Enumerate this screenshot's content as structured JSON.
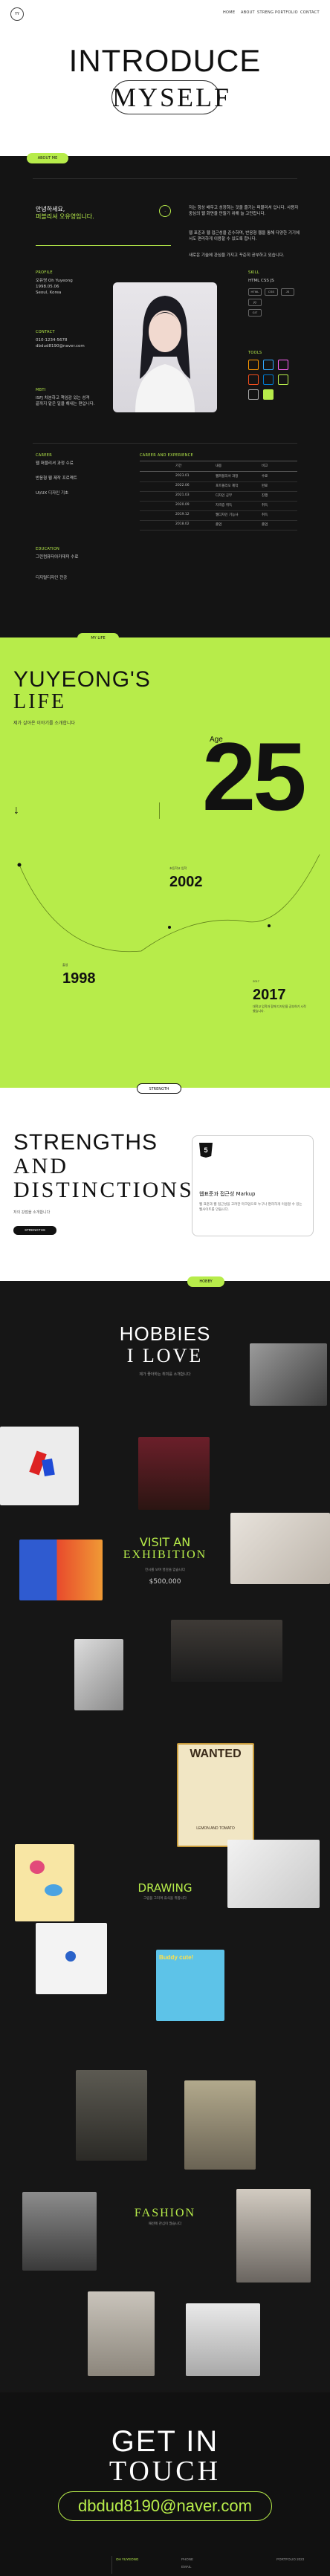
{
  "header": {
    "logo": "YY",
    "nav": [
      "HOME",
      "ABOUT",
      "STRENG",
      "PORTFOLIO",
      "CONTACT"
    ],
    "title_line1": "INTRODUCE",
    "title_line2": "MYSELF"
  },
  "about": {
    "tab": "ABOUT ME",
    "greeting_line1": "안녕하세요,",
    "greeting_line2": "퍼블리셔 오유영입니다.",
    "intro_paragraph": "저는 항상 배우고 성장하는 것을 즐기는 퍼블리셔 입니다. 사용자 중심의 웹 화면을 만들기 위해 늘 고민합니다.",
    "intro_paragraph2": "웹 표준과 웹 접근성을 준수하며, 반응형 웹을 통해 다양한 기기에서도 편리하게 이용할 수 있도록 합니다.",
    "intro_paragraph3": "새로운 기술에 관심을 가지고 꾸준히 공부하고 있습니다.",
    "profile_label": "PROFILE",
    "profile_name": "오유영 Oh Yuyeong",
    "profile_birth": "1998.05.06",
    "profile_addr": "Seoul, Korea",
    "contact_label": "CONTACT",
    "contact_phone": "010-1234-5678",
    "contact_email": "dbdud8190@naver.com",
    "mbti_label": "MBTI",
    "mbti_text": "ISFJ 차분하고 책임감 있는 성격",
    "mbti_text2": "끝까지 맡은 일을 해내는 편입니다.",
    "skill_label": "SKILL",
    "skill_text": "HTML CSS JS",
    "tools_label": "TOOLS",
    "career_label": "CAREER",
    "career_lines": [
      "웹 퍼블리셔 과정 수료",
      "반응형 웹 제작 프로젝트",
      "UI/UX 디자인 기초"
    ],
    "edu_label": "EDUCATION",
    "edu_lines": [
      "그린컴퓨터아카데미 수료",
      "디지털디자인 전공"
    ],
    "table_title": "CAREER AND EXPERIENCE",
    "table_header": [
      "기간",
      "내용",
      "비고"
    ],
    "table_rows": [
      [
        "2023.01",
        "웹퍼블리셔 과정",
        "수료"
      ],
      [
        "2022.06",
        "포트폴리오 제작",
        "완료"
      ],
      [
        "2021.03",
        "디자인 공부",
        "진행"
      ],
      [
        "2020.09",
        "자격증 취득",
        "취득"
      ],
      [
        "2019.12",
        "웹디자인 기능사",
        "취득"
      ],
      [
        "2018.02",
        "졸업",
        "졸업"
      ]
    ]
  },
  "life": {
    "tab": "MY LIFE",
    "title1": "YUYEONG'S",
    "title2": "LIFE",
    "subtitle": "제가 살아온 이야기를 소개합니다",
    "age_label": "Age",
    "age_value": "25",
    "years": [
      {
        "year": "2002",
        "note": "초등학교 입학"
      },
      {
        "year": "1998",
        "note": "출생"
      },
      {
        "year": "2017",
        "note": "대학교 입학과 함께 디자인을 공부하기 시작했습니다."
      }
    ]
  },
  "strengths": {
    "tab": "STRENGTH",
    "title1": "STRENGTHS",
    "title2": "AND",
    "title3": "DISTINCTIONS",
    "desc": "저의 강점을 소개합니다",
    "button": "STRENGTHS",
    "card_title": "웹표준과 접근성 Markup",
    "card_text": "웹 표준과 웹 접근성을 고려한 마크업으로 누구나 편리하게 이용할 수 있는 웹사이트를 만듭니다."
  },
  "hobbies": {
    "tab": "HOBBY",
    "title1": "HOBBIES",
    "title2": "I LOVE",
    "desc": "제가 좋아하는 취미를 소개합니다",
    "cat1": "VISIT AN",
    "cat1b": "EXHIBITION",
    "cat1_text": "전시를 보며 영감을 얻습니다",
    "cat1_price": "$500,000",
    "cat2": "DRAWING",
    "cat2_text": "그림을 그리며 휴식을 취합니다",
    "cat3": "FASHION",
    "cat3_text": "패션에 관심이 많습니다",
    "sign_wanted": "WANTED",
    "sign_sub": "LEMON AND TOMATO",
    "sign_cute": "Buddy cute!"
  },
  "contact": {
    "title1": "GET IN",
    "title2": "TOUCH",
    "email": "dbdud8190@naver.com",
    "footer_left": "OH YUYEONG",
    "footer_mid": "PHONE",
    "footer_email": "EMAIL",
    "footer_right": "PORTFOLIO 2023"
  }
}
